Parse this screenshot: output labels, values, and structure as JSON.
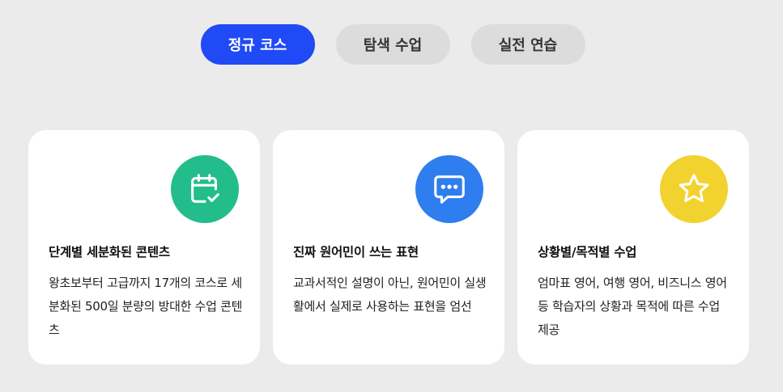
{
  "tabs": [
    {
      "label": "정규 코스",
      "active": true
    },
    {
      "label": "탐색 수업",
      "active": false
    },
    {
      "label": "실전 연습",
      "active": false
    }
  ],
  "cards": [
    {
      "icon": "calendar-check-icon",
      "icon_color": "#22bd8a",
      "title": "단계별 세분화된 콘텐츠",
      "description": "왕초보부터 고급까지 17개의 코스로 세분화된 500일 분량의 방대한 수업 콘텐츠"
    },
    {
      "icon": "chat-bubble-icon",
      "icon_color": "#2f7ef0",
      "title": "진짜 원어민이 쓰는 표현",
      "description": "교과서적인 설명이 아닌, 원어민이 실생활에서 실제로 사용하는 표현을 엄선"
    },
    {
      "icon": "star-icon",
      "icon_color": "#f2d22e",
      "title": "상황별/목적별 수업",
      "description": "엄마표 영어, 여행 영어, 비즈니스 영어 등 학습자의 상황과 목적에 따른 수업 제공"
    }
  ]
}
